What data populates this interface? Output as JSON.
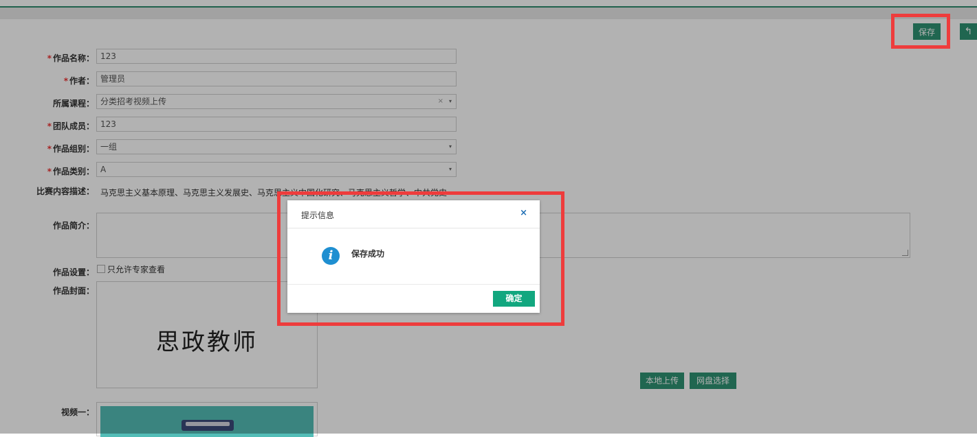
{
  "toolbar": {
    "save_label": "保存",
    "back_icon": "↰"
  },
  "form": {
    "work_name": {
      "label": "作品名称：",
      "value": "123",
      "required": "*"
    },
    "author": {
      "label": "作者：",
      "value": "管理员",
      "required": "*"
    },
    "course": {
      "label": "所属课程：",
      "value": "分类招考视频上传",
      "clear": "×",
      "caret": "▾"
    },
    "team": {
      "label": "团队成员：",
      "value": "123",
      "required": "*"
    },
    "group": {
      "label": "作品组别：",
      "value": "一组",
      "required": "*",
      "caret": "▾"
    },
    "category": {
      "label": "作品类别：",
      "value": "A",
      "required": "*",
      "caret": "▾"
    },
    "description": {
      "label": "比赛内容描述：",
      "value": "马克思主义基本原理、马克思主义发展史、马克思主义中国化研究、马克思主义哲学、中共党史"
    },
    "intro": {
      "label": "作品简介："
    },
    "settings": {
      "label": "作品设置：",
      "option": "只允许专家查看"
    },
    "cover": {
      "label": "作品封面：",
      "image_text": "思政教师"
    },
    "upload_local": "本地上传",
    "netdisk_select": "网盘选择",
    "video1": {
      "label": "视频一："
    }
  },
  "dialog": {
    "title": "提示信息",
    "close": "×",
    "icon_glyph": "i",
    "message": "保存成功",
    "ok_label": "确定"
  },
  "colors": {
    "primary": "#2f9273",
    "highlight": "#ee3c3c",
    "ok": "#12a77f",
    "info": "#1f8fd1"
  }
}
